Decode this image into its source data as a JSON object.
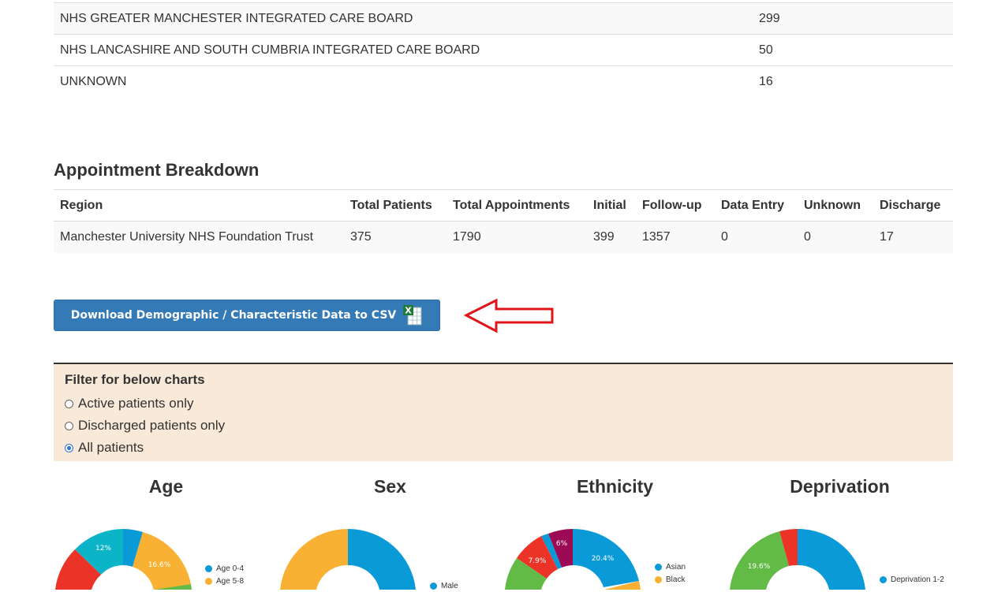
{
  "icb_table": {
    "rows": [
      {
        "name": "NHS GREATER MANCHESTER INTEGRATED CARE BOARD",
        "count": "299"
      },
      {
        "name": "NHS LANCASHIRE AND SOUTH CUMBRIA INTEGRATED CARE BOARD",
        "count": "50"
      },
      {
        "name": "UNKNOWN",
        "count": "16"
      }
    ]
  },
  "appointments": {
    "title": "Appointment Breakdown",
    "headers": [
      "Region",
      "Total Patients",
      "Total Appointments",
      "Initial",
      "Follow-up",
      "Data Entry",
      "Unknown",
      "Discharge"
    ],
    "rows": [
      [
        "Manchester University NHS Foundation Trust",
        "375",
        "1790",
        "399",
        "1357",
        "0",
        "0",
        "17"
      ]
    ]
  },
  "download_button": {
    "label": "Download Demographic / Characteristic Data to CSV",
    "icon": "excel-icon"
  },
  "filter": {
    "title": "Filter for below charts",
    "options": [
      {
        "label": "Active patients only",
        "selected": false
      },
      {
        "label": "Discharged patients only",
        "selected": false
      },
      {
        "label": "All patients",
        "selected": true
      }
    ]
  },
  "charts": {
    "age": {
      "title": "Age",
      "legend": [
        "Age 0-4",
        "Age 5-8"
      ],
      "labels": [
        "16.6%",
        "12%"
      ]
    },
    "sex": {
      "title": "Sex",
      "legend": [
        "Male"
      ]
    },
    "ethnicity": {
      "title": "Ethnicity",
      "legend": [
        "Asian",
        "Black"
      ],
      "labels": [
        "20.4%",
        "7.9%",
        "6%"
      ]
    },
    "deprivation": {
      "title": "Deprivation",
      "legend": [
        "Deprivation 1-2"
      ],
      "labels": [
        "19.6%"
      ]
    }
  },
  "colors": {
    "blue": "#0b9ad8",
    "orange": "#f8b133",
    "green": "#63bb47",
    "red": "#ec3328",
    "teal": "#0bb5c7",
    "maroon": "#9c0a55",
    "button": "#337ab7",
    "filter_bg": "#f8e9d8",
    "arrow": "#e0141b"
  }
}
